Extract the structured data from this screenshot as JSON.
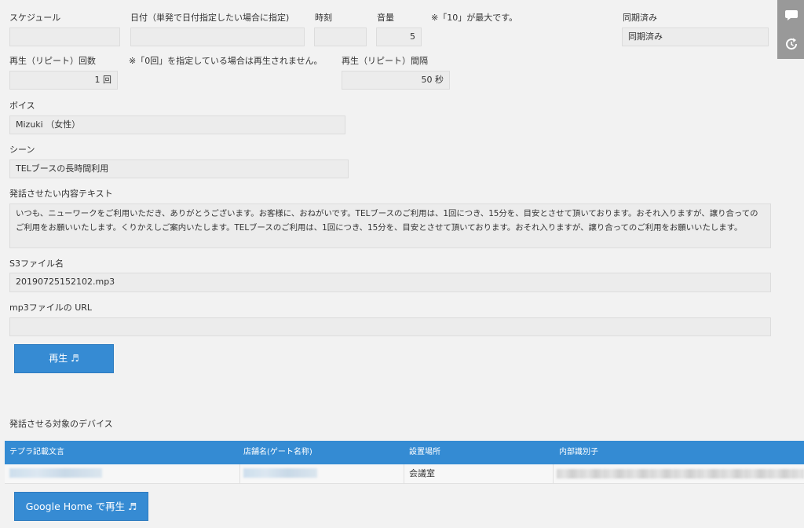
{
  "schedule": {
    "label": "スケジュール",
    "value": ""
  },
  "date": {
    "label": "日付（単発で日付指定したい場合に指定)",
    "value": ""
  },
  "time": {
    "label": "時刻",
    "value": ""
  },
  "volume": {
    "label": "音量",
    "value": "5",
    "note": "※「10」が最大です。"
  },
  "sync": {
    "label": "同期済み",
    "value": "同期済み"
  },
  "repeat_count": {
    "label": "再生（リピート）回数",
    "value": "1 回",
    "note": "※「0回」を指定している場合は再生されません。"
  },
  "repeat_interval": {
    "label": "再生（リピート）間隔",
    "value": "50 秒"
  },
  "voice": {
    "label": "ボイス",
    "value": "Mizuki （女性）"
  },
  "scene": {
    "label": "シーン",
    "value": "TELブースの長時間利用"
  },
  "speech_text": {
    "label": "発話させたい内容テキスト",
    "value": "いつも、ニューワークをご利用いただき、ありがとうございます。お客様に、おねがいです。TELブースのご利用は、1回につき、15分を、目安とさせて頂いております。おそれ入りますが、譲り合ってのご利用をお願いいたします。くりかえしご案内いたします。TELブースのご利用は、1回につき、15分を、目安とさせて頂いております。おそれ入りますが、譲り合ってのご利用をお願いいたします。"
  },
  "s3_file": {
    "label": "S3ファイル名",
    "value": "20190725152102.mp3"
  },
  "mp3_url": {
    "label": "mp3ファイルの URL",
    "value": ""
  },
  "play_button": "再生 ♬",
  "devices": {
    "label": "発話させる対象のデバイス",
    "columns": [
      "テプラ記載文言",
      "店舗名(ゲート名称)",
      "設置場所",
      "内部識別子"
    ],
    "rows": [
      {
        "tepra": "",
        "store": "",
        "location": "会議室",
        "internal_id": ""
      }
    ]
  },
  "google_home_button": "Google Home で再生 ♬",
  "side_icons": [
    "chat-icon",
    "refresh-icon"
  ]
}
